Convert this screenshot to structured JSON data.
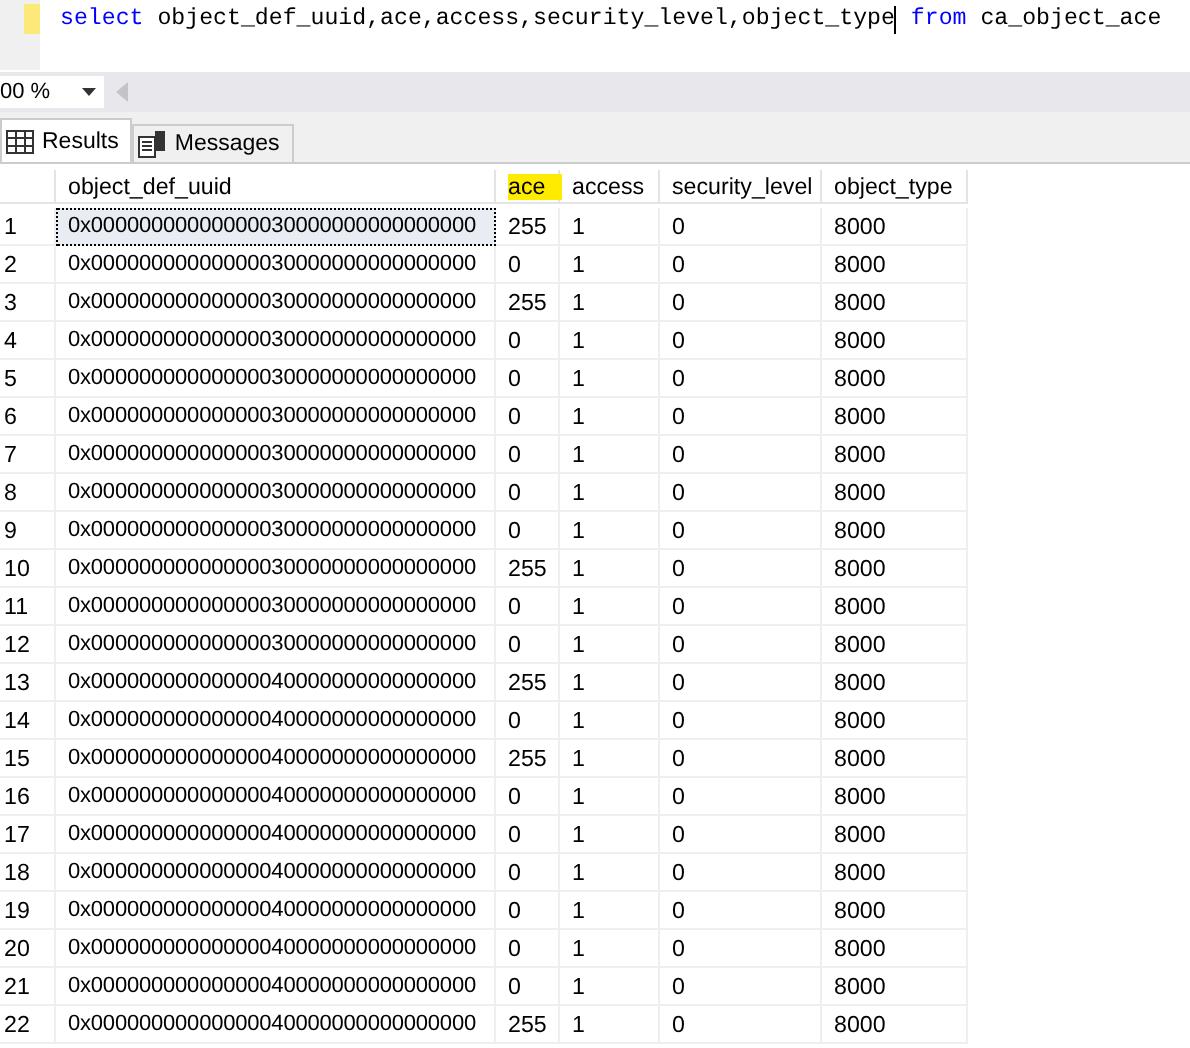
{
  "editor": {
    "tokens": [
      {
        "text": "select",
        "kind": "keyword"
      },
      {
        "text": " object_def_uuid,ace,access,security_level,object_type",
        "kind": "plain"
      },
      {
        "kind": "cursor"
      },
      {
        "text": " from",
        "kind": "keyword"
      },
      {
        "text": " ca_object_ace",
        "kind": "plain"
      }
    ]
  },
  "zoom": {
    "value": "00 %"
  },
  "tabs": [
    {
      "label": "Results",
      "selected": true
    },
    {
      "label": "Messages",
      "selected": false
    }
  ],
  "grid": {
    "columns": [
      {
        "label": "object_def_uuid",
        "highlighted": false
      },
      {
        "label": "ace",
        "highlighted": true
      },
      {
        "label": "access",
        "highlighted": false
      },
      {
        "label": "security_level",
        "highlighted": false
      },
      {
        "label": "object_type",
        "highlighted": false
      }
    ],
    "rows": [
      {
        "n": "1",
        "cells": [
          "0x00000000000000030000000000000000",
          "255",
          "1",
          "0",
          "8000"
        ],
        "selected": true
      },
      {
        "n": "2",
        "cells": [
          "0x00000000000000030000000000000000",
          "0",
          "1",
          "0",
          "8000"
        ],
        "selected": false
      },
      {
        "n": "3",
        "cells": [
          "0x00000000000000030000000000000000",
          "255",
          "1",
          "0",
          "8000"
        ],
        "selected": false
      },
      {
        "n": "4",
        "cells": [
          "0x00000000000000030000000000000000",
          "0",
          "1",
          "0",
          "8000"
        ],
        "selected": false
      },
      {
        "n": "5",
        "cells": [
          "0x00000000000000030000000000000000",
          "0",
          "1",
          "0",
          "8000"
        ],
        "selected": false
      },
      {
        "n": "6",
        "cells": [
          "0x00000000000000030000000000000000",
          "0",
          "1",
          "0",
          "8000"
        ],
        "selected": false
      },
      {
        "n": "7",
        "cells": [
          "0x00000000000000030000000000000000",
          "0",
          "1",
          "0",
          "8000"
        ],
        "selected": false
      },
      {
        "n": "8",
        "cells": [
          "0x00000000000000030000000000000000",
          "0",
          "1",
          "0",
          "8000"
        ],
        "selected": false
      },
      {
        "n": "9",
        "cells": [
          "0x00000000000000030000000000000000",
          "0",
          "1",
          "0",
          "8000"
        ],
        "selected": false
      },
      {
        "n": "10",
        "cells": [
          "0x00000000000000030000000000000000",
          "255",
          "1",
          "0",
          "8000"
        ],
        "selected": false
      },
      {
        "n": "11",
        "cells": [
          "0x00000000000000030000000000000000",
          "0",
          "1",
          "0",
          "8000"
        ],
        "selected": false
      },
      {
        "n": "12",
        "cells": [
          "0x00000000000000030000000000000000",
          "0",
          "1",
          "0",
          "8000"
        ],
        "selected": false
      },
      {
        "n": "13",
        "cells": [
          "0x00000000000000040000000000000000",
          "255",
          "1",
          "0",
          "8000"
        ],
        "selected": false
      },
      {
        "n": "14",
        "cells": [
          "0x00000000000000040000000000000000",
          "0",
          "1",
          "0",
          "8000"
        ],
        "selected": false
      },
      {
        "n": "15",
        "cells": [
          "0x00000000000000040000000000000000",
          "255",
          "1",
          "0",
          "8000"
        ],
        "selected": false
      },
      {
        "n": "16",
        "cells": [
          "0x00000000000000040000000000000000",
          "0",
          "1",
          "0",
          "8000"
        ],
        "selected": false
      },
      {
        "n": "17",
        "cells": [
          "0x00000000000000040000000000000000",
          "0",
          "1",
          "0",
          "8000"
        ],
        "selected": false
      },
      {
        "n": "18",
        "cells": [
          "0x00000000000000040000000000000000",
          "0",
          "1",
          "0",
          "8000"
        ],
        "selected": false
      },
      {
        "n": "19",
        "cells": [
          "0x00000000000000040000000000000000",
          "0",
          "1",
          "0",
          "8000"
        ],
        "selected": false
      },
      {
        "n": "20",
        "cells": [
          "0x00000000000000040000000000000000",
          "0",
          "1",
          "0",
          "8000"
        ],
        "selected": false
      },
      {
        "n": "21",
        "cells": [
          "0x00000000000000040000000000000000",
          "0",
          "1",
          "0",
          "8000"
        ],
        "selected": false
      },
      {
        "n": "22",
        "cells": [
          "0x00000000000000040000000000000000",
          "255",
          "1",
          "0",
          "8000"
        ],
        "selected": false
      }
    ]
  }
}
